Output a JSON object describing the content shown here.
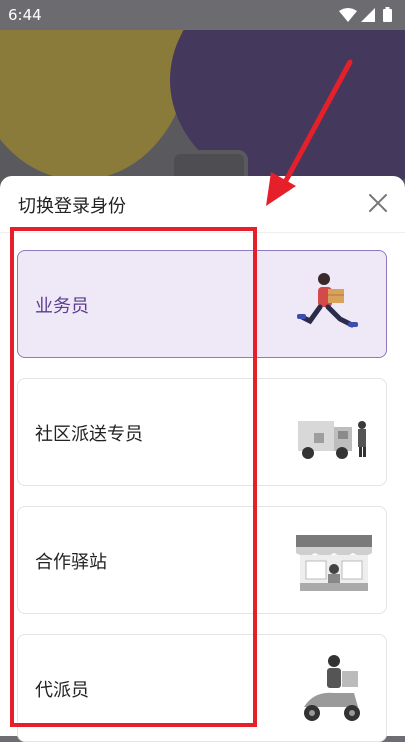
{
  "status_bar": {
    "time": "6:44"
  },
  "sheet": {
    "title": "切换登录身份",
    "close_icon": "close-icon"
  },
  "roles": [
    {
      "label": "业务员",
      "selected": true,
      "icon": "courier-running-illustration"
    },
    {
      "label": "社区派送专员",
      "selected": false,
      "icon": "delivery-truck-illustration"
    },
    {
      "label": "合作驿站",
      "selected": false,
      "icon": "storefront-illustration"
    },
    {
      "label": "代派员",
      "selected": false,
      "icon": "scooter-courier-illustration"
    }
  ],
  "colors": {
    "accent": "#8e79be",
    "selected_bg": "#efe9f7",
    "selected_text": "#5a3d8e",
    "annotation": "#e6202a"
  }
}
